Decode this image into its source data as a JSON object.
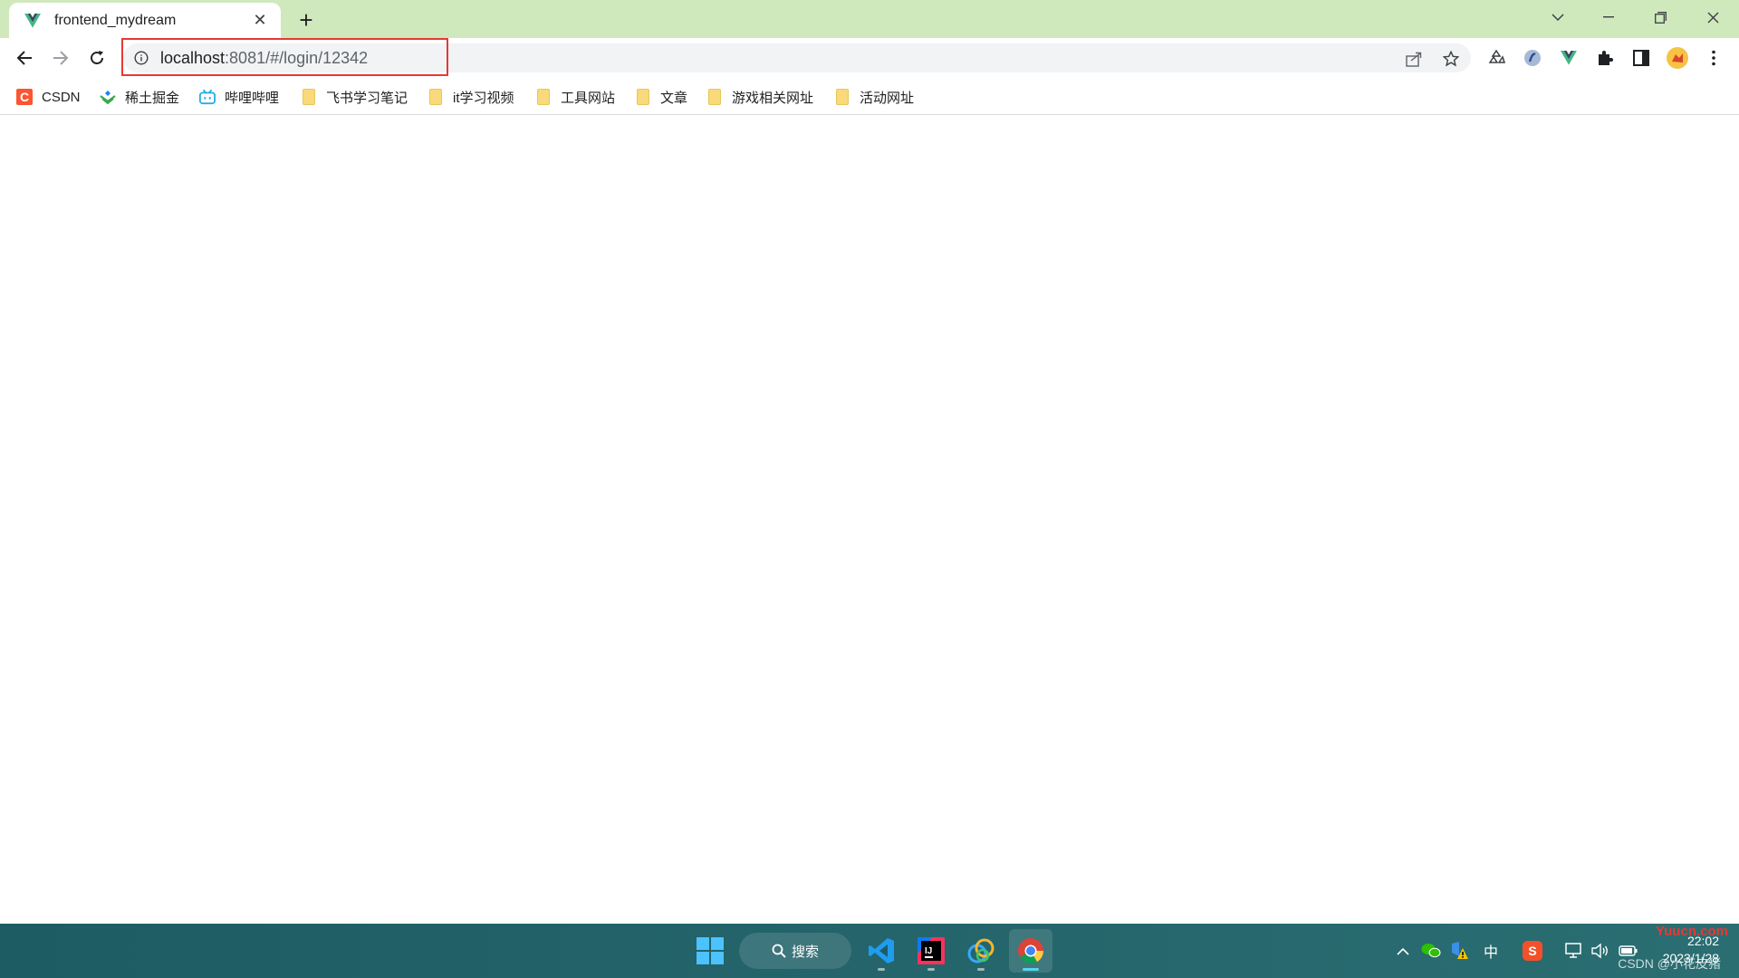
{
  "browser": {
    "tab": {
      "title": "frontend_mydream",
      "favicon": "vue-logo-icon",
      "close_glyph": "✕"
    },
    "new_tab_glyph": "+",
    "omnibox": {
      "url_host": "localhost",
      "url_rest": ":8081/#/login/12342"
    },
    "extensions": [
      "recycle-icon",
      "blue-circle-icon",
      "vue-devtools-icon",
      "puzzle-icon",
      "sidebar-icon",
      "profile-avatar-icon",
      "more-menu-icon"
    ]
  },
  "bookmarks": [
    {
      "label": "CSDN",
      "icon": "csdn-icon"
    },
    {
      "label": "稀土掘金",
      "icon": "juejin-icon"
    },
    {
      "label": "哔哩哔哩",
      "icon": "bilibili-icon"
    },
    {
      "label": "飞书学习笔记",
      "icon": "folder-icon"
    },
    {
      "label": "it学习视频",
      "icon": "folder-icon"
    },
    {
      "label": "工具网站",
      "icon": "folder-icon"
    },
    {
      "label": "文章",
      "icon": "folder-icon"
    },
    {
      "label": "游戏相关网址",
      "icon": "folder-icon"
    },
    {
      "label": "活动网址",
      "icon": "folder-icon"
    }
  ],
  "taskbar": {
    "search_label": "搜索",
    "apps": [
      "windows-start-icon",
      "vscode-icon",
      "intellij-icon",
      "browser-alt-icon",
      "chrome-icon"
    ],
    "tray_ime": "中",
    "clock_time": "22:02",
    "clock_date": "2023/1/28",
    "watermark_site": "Yuucn.com",
    "watermark_author": "CSDN @小花皮猪"
  },
  "colors": {
    "titlebar": "#cfe9bd",
    "taskbar": "#1e5c63",
    "highlight": "#e53935"
  }
}
